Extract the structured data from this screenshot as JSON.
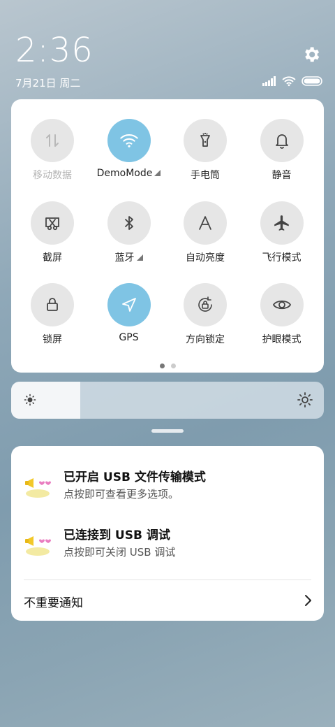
{
  "header": {
    "time": "2:36",
    "date": "7月21日 周二"
  },
  "tiles": [
    {
      "label": "移动数据",
      "icon": "mobile-data-icon",
      "active": false,
      "dim": true
    },
    {
      "label": "DemoMode",
      "icon": "wifi-icon",
      "active": true,
      "expandable": true
    },
    {
      "label": "手电筒",
      "icon": "flashlight-icon",
      "active": false
    },
    {
      "label": "静音",
      "icon": "bell-icon",
      "active": false
    },
    {
      "label": "截屏",
      "icon": "screenshot-icon",
      "active": false
    },
    {
      "label": "蓝牙",
      "icon": "bluetooth-icon",
      "active": false,
      "expandable": true
    },
    {
      "label": "自动亮度",
      "icon": "auto-brightness-icon",
      "active": false
    },
    {
      "label": "飞行模式",
      "icon": "airplane-icon",
      "active": false
    },
    {
      "label": "锁屏",
      "icon": "lock-icon",
      "active": false
    },
    {
      "label": "GPS",
      "icon": "location-arrow-icon",
      "active": true
    },
    {
      "label": "方向锁定",
      "icon": "rotation-lock-icon",
      "active": false
    },
    {
      "label": "护眼模式",
      "icon": "eye-icon",
      "active": false
    }
  ],
  "pager": {
    "pages": 2,
    "current": 1
  },
  "brightness": {
    "level": 0.22
  },
  "notifications": [
    {
      "title": "已开启 USB 文件传输模式",
      "subtitle": "点按即可查看更多选项。",
      "icon": "usb-app-icon"
    },
    {
      "title": "已连接到 USB 调试",
      "subtitle": "点按即可关闭 USB 调试",
      "icon": "usb-app-icon"
    }
  ],
  "unimportant": {
    "label": "不重要通知"
  },
  "colors": {
    "active_tile": "#7fc4e4",
    "inactive_tile": "#e6e6e6"
  }
}
